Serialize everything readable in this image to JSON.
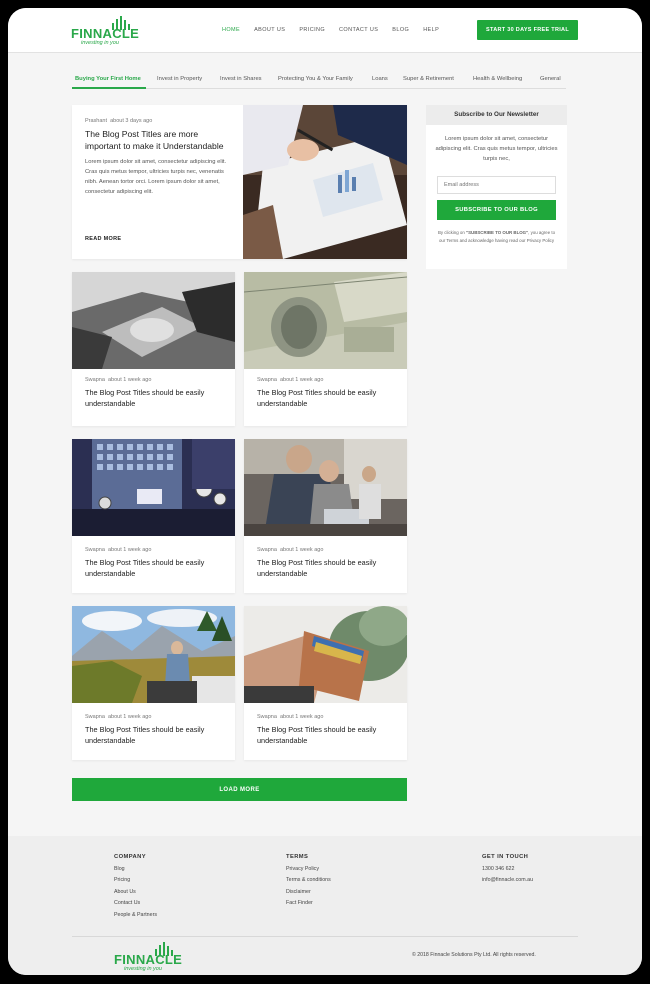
{
  "brand": {
    "name": "FINNACLE",
    "tagline": "investing in you",
    "accent": "#1fa83b"
  },
  "nav": {
    "items": [
      "HOME",
      "ABOUT US",
      "PRICING",
      "CONTACT US",
      "BLOG",
      "HELP"
    ],
    "active": "HOME",
    "cta": "START 30 DAYS FREE TRIAL"
  },
  "categories": {
    "items": [
      "Buying Your First Home",
      "Invest in Property",
      "Invest in Shares",
      "Protecting You & Your Family",
      "Loans",
      "Super & Retirement",
      "Health & Wellbeing",
      "General"
    ],
    "active": "Buying Your First Home"
  },
  "featured": {
    "author": "Prashant",
    "time": "about 3 days ago",
    "title": "The Blog Post Titles are more important to make it Understandable",
    "excerpt": "Lorem ipsum dolor sit amet, consectetur adipiscing elit. Cras quis metus tempor, ultricies turpis nec, venenatis nibh. Aenean tortor orci. Lorem ipsum dolor sit amet, consectetur adipiscing elit.",
    "read_more": "READ MORE",
    "image": "hands-signing-document-photo"
  },
  "posts": [
    {
      "author": "Swapna",
      "time": "about 1 week ago",
      "title": "The Blog Post Titles should be easily understandable",
      "image": "handshake-bw-photo"
    },
    {
      "author": "Swapna",
      "time": "about 1 week ago",
      "title": "The Blog Post Titles should be easily understandable",
      "image": "dollar-bills-photo"
    },
    {
      "author": "Swapna",
      "time": "about 1 week ago",
      "title": "The Blog Post Titles should be easily understandable",
      "image": "city-clocks-photo"
    },
    {
      "author": "Swapna",
      "time": "about 1 week ago",
      "title": "The Blog Post Titles should be easily understandable",
      "image": "office-meeting-photo"
    },
    {
      "author": "Swapna",
      "time": "about 1 week ago",
      "title": "The Blog Post Titles should be easily understandable",
      "image": "mountain-road-trip-photo"
    },
    {
      "author": "Swapna",
      "time": "about 1 week ago",
      "title": "The Blog Post Titles should be easily understandable",
      "image": "leather-wallet-photo"
    }
  ],
  "load_more": "LOAD MORE",
  "newsletter": {
    "heading": "Subscribe to Our Newsletter",
    "description": "Lorem ipsum dolor sit amet, consectetur adipiscing elit. Cras quis metus tempor, ultricies turpis nec,",
    "email_placeholder": "Email address",
    "button": "SUBSCRIBE TO OUR BLOG",
    "note_prefix": "By clicking on ",
    "note_bold": "\"SUBSCRIBE TO OUR BLOG\"",
    "note_suffix": ", you agree to our Terms and acknowledge having read our Privacy Policy"
  },
  "footer": {
    "company": {
      "heading": "COMPANY",
      "links": [
        "Blog",
        "Pricing",
        "About Us",
        "Contact Us",
        "People & Partners"
      ]
    },
    "terms": {
      "heading": "TERMS",
      "links": [
        "Privacy Policy",
        "Terms & conditions",
        "Disclaimer",
        "Fact Finder"
      ]
    },
    "contact": {
      "heading": "GET IN TOUCH",
      "phone": "1300 346 622",
      "email": "info@finnacle.com.au"
    },
    "copyright": "© 2018 Finnacle Solutions Pty Ltd. All rights reserved."
  }
}
